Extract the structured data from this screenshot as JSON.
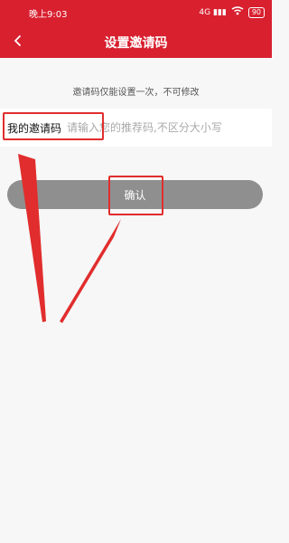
{
  "status_bar": {
    "time": "晚上9:03",
    "signal": "4G ▮▮▮",
    "wifi": "WiFi",
    "battery": "90"
  },
  "app_bar": {
    "title": "设置邀请码"
  },
  "notice": "邀请码仅能设置一次，不可修改",
  "invite_field": {
    "label": "我的邀请码",
    "placeholder": "请输入您的推荐码,不区分大小写",
    "value": ""
  },
  "confirm_button": {
    "label": "确认"
  },
  "colors": {
    "primary": "#d8202f",
    "button": "#8f8f8f",
    "annotation": "#e12d2d"
  },
  "icons": {
    "back": "chevron-left-icon",
    "wifi": "wifi-icon",
    "battery": "battery-icon"
  }
}
